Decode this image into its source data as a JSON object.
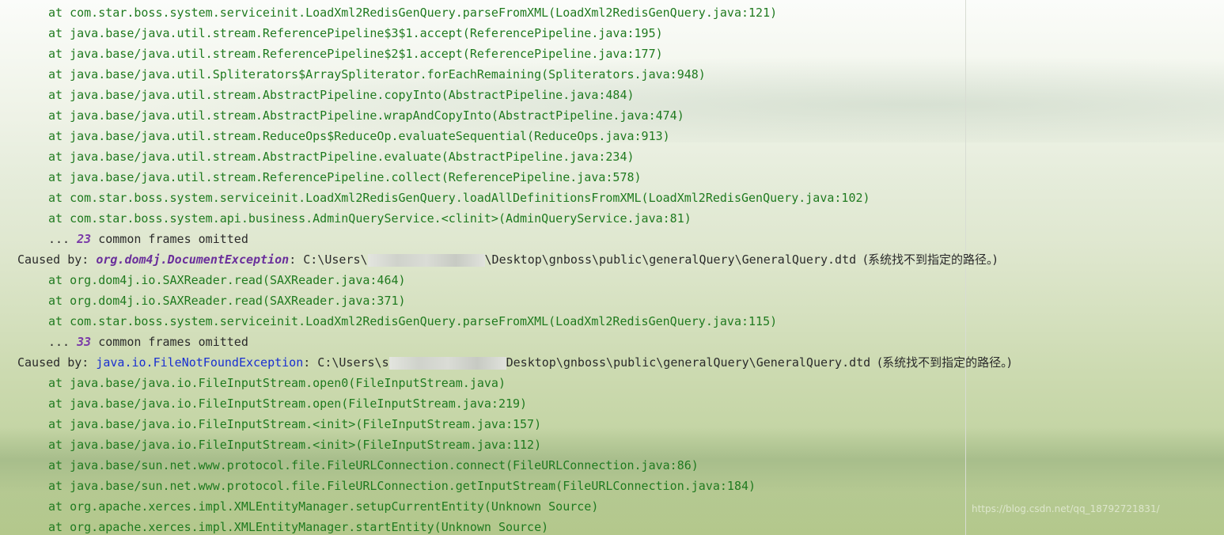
{
  "frames_top": [
    "at com.star.boss.system.serviceinit.LoadXml2RedisGenQuery.parseFromXML(LoadXml2RedisGenQuery.java:121)",
    "at java.base/java.util.stream.ReferencePipeline$3$1.accept(ReferencePipeline.java:195)",
    "at java.base/java.util.stream.ReferencePipeline$2$1.accept(ReferencePipeline.java:177)",
    "at java.base/java.util.Spliterators$ArraySpliterator.forEachRemaining(Spliterators.java:948)",
    "at java.base/java.util.stream.AbstractPipeline.copyInto(AbstractPipeline.java:484)",
    "at java.base/java.util.stream.AbstractPipeline.wrapAndCopyInto(AbstractPipeline.java:474)",
    "at java.base/java.util.stream.ReduceOps$ReduceOp.evaluateSequential(ReduceOps.java:913)",
    "at java.base/java.util.stream.AbstractPipeline.evaluate(AbstractPipeline.java:234)",
    "at java.base/java.util.stream.ReferencePipeline.collect(ReferencePipeline.java:578)",
    "at com.star.boss.system.serviceinit.LoadXml2RedisGenQuery.loadAllDefinitionsFromXML(LoadXml2RedisGenQuery.java:102)",
    "at com.star.boss.system.api.business.AdminQueryService.<clinit>(AdminQueryService.java:81)"
  ],
  "omitted_1": {
    "prefix": "... ",
    "count": "23",
    "suffix": " common frames omitted"
  },
  "caused_1": {
    "prefix": "Caused by: ",
    "exception": "org.dom4j.DocumentException",
    "path_start": ": C:\\Users\\",
    "path_end": "\\Desktop\\gnboss\\public\\generalQuery\\GeneralQuery.dtd ",
    "message": "(系统找不到指定的路径。)"
  },
  "frames_mid": [
    "at org.dom4j.io.SAXReader.read(SAXReader.java:464)",
    "at org.dom4j.io.SAXReader.read(SAXReader.java:371)",
    "at com.star.boss.system.serviceinit.LoadXml2RedisGenQuery.parseFromXML(LoadXml2RedisGenQuery.java:115)"
  ],
  "omitted_2": {
    "prefix": "... ",
    "count": "33",
    "suffix": " common frames omitted"
  },
  "caused_2": {
    "prefix": "Caused by: ",
    "exception": "java.io.FileNotFoundException",
    "path_start": ": C:\\Users\\s",
    "path_end": "Desktop\\gnboss\\public\\generalQuery\\GeneralQuery.dtd ",
    "message": "(系统找不到指定的路径。)"
  },
  "frames_bottom": [
    "at java.base/java.io.FileInputStream.open0(FileInputStream.java)",
    "at java.base/java.io.FileInputStream.open(FileInputStream.java:219)",
    "at java.base/java.io.FileInputStream.<init>(FileInputStream.java:157)",
    "at java.base/java.io.FileInputStream.<init>(FileInputStream.java:112)",
    "at java.base/sun.net.www.protocol.file.FileURLConnection.connect(FileURLConnection.java:86)",
    "at java.base/sun.net.www.protocol.file.FileURLConnection.getInputStream(FileURLConnection.java:184)",
    "at org.apache.xerces.impl.XMLEntityManager.setupCurrentEntity(Unknown Source)",
    "at org.apache.xerces.impl.XMLEntityManager.startEntity(Unknown Source)"
  ],
  "watermark": "https://blog.csdn.net/qq_18792721831/",
  "colors": {
    "frame_text": "#1f7a1f",
    "plain_text": "#2b2b2b",
    "exception_purple": "#6a2f9b",
    "exception_blue": "#1a2fd1",
    "omitted_count": "#7a3aa8"
  }
}
